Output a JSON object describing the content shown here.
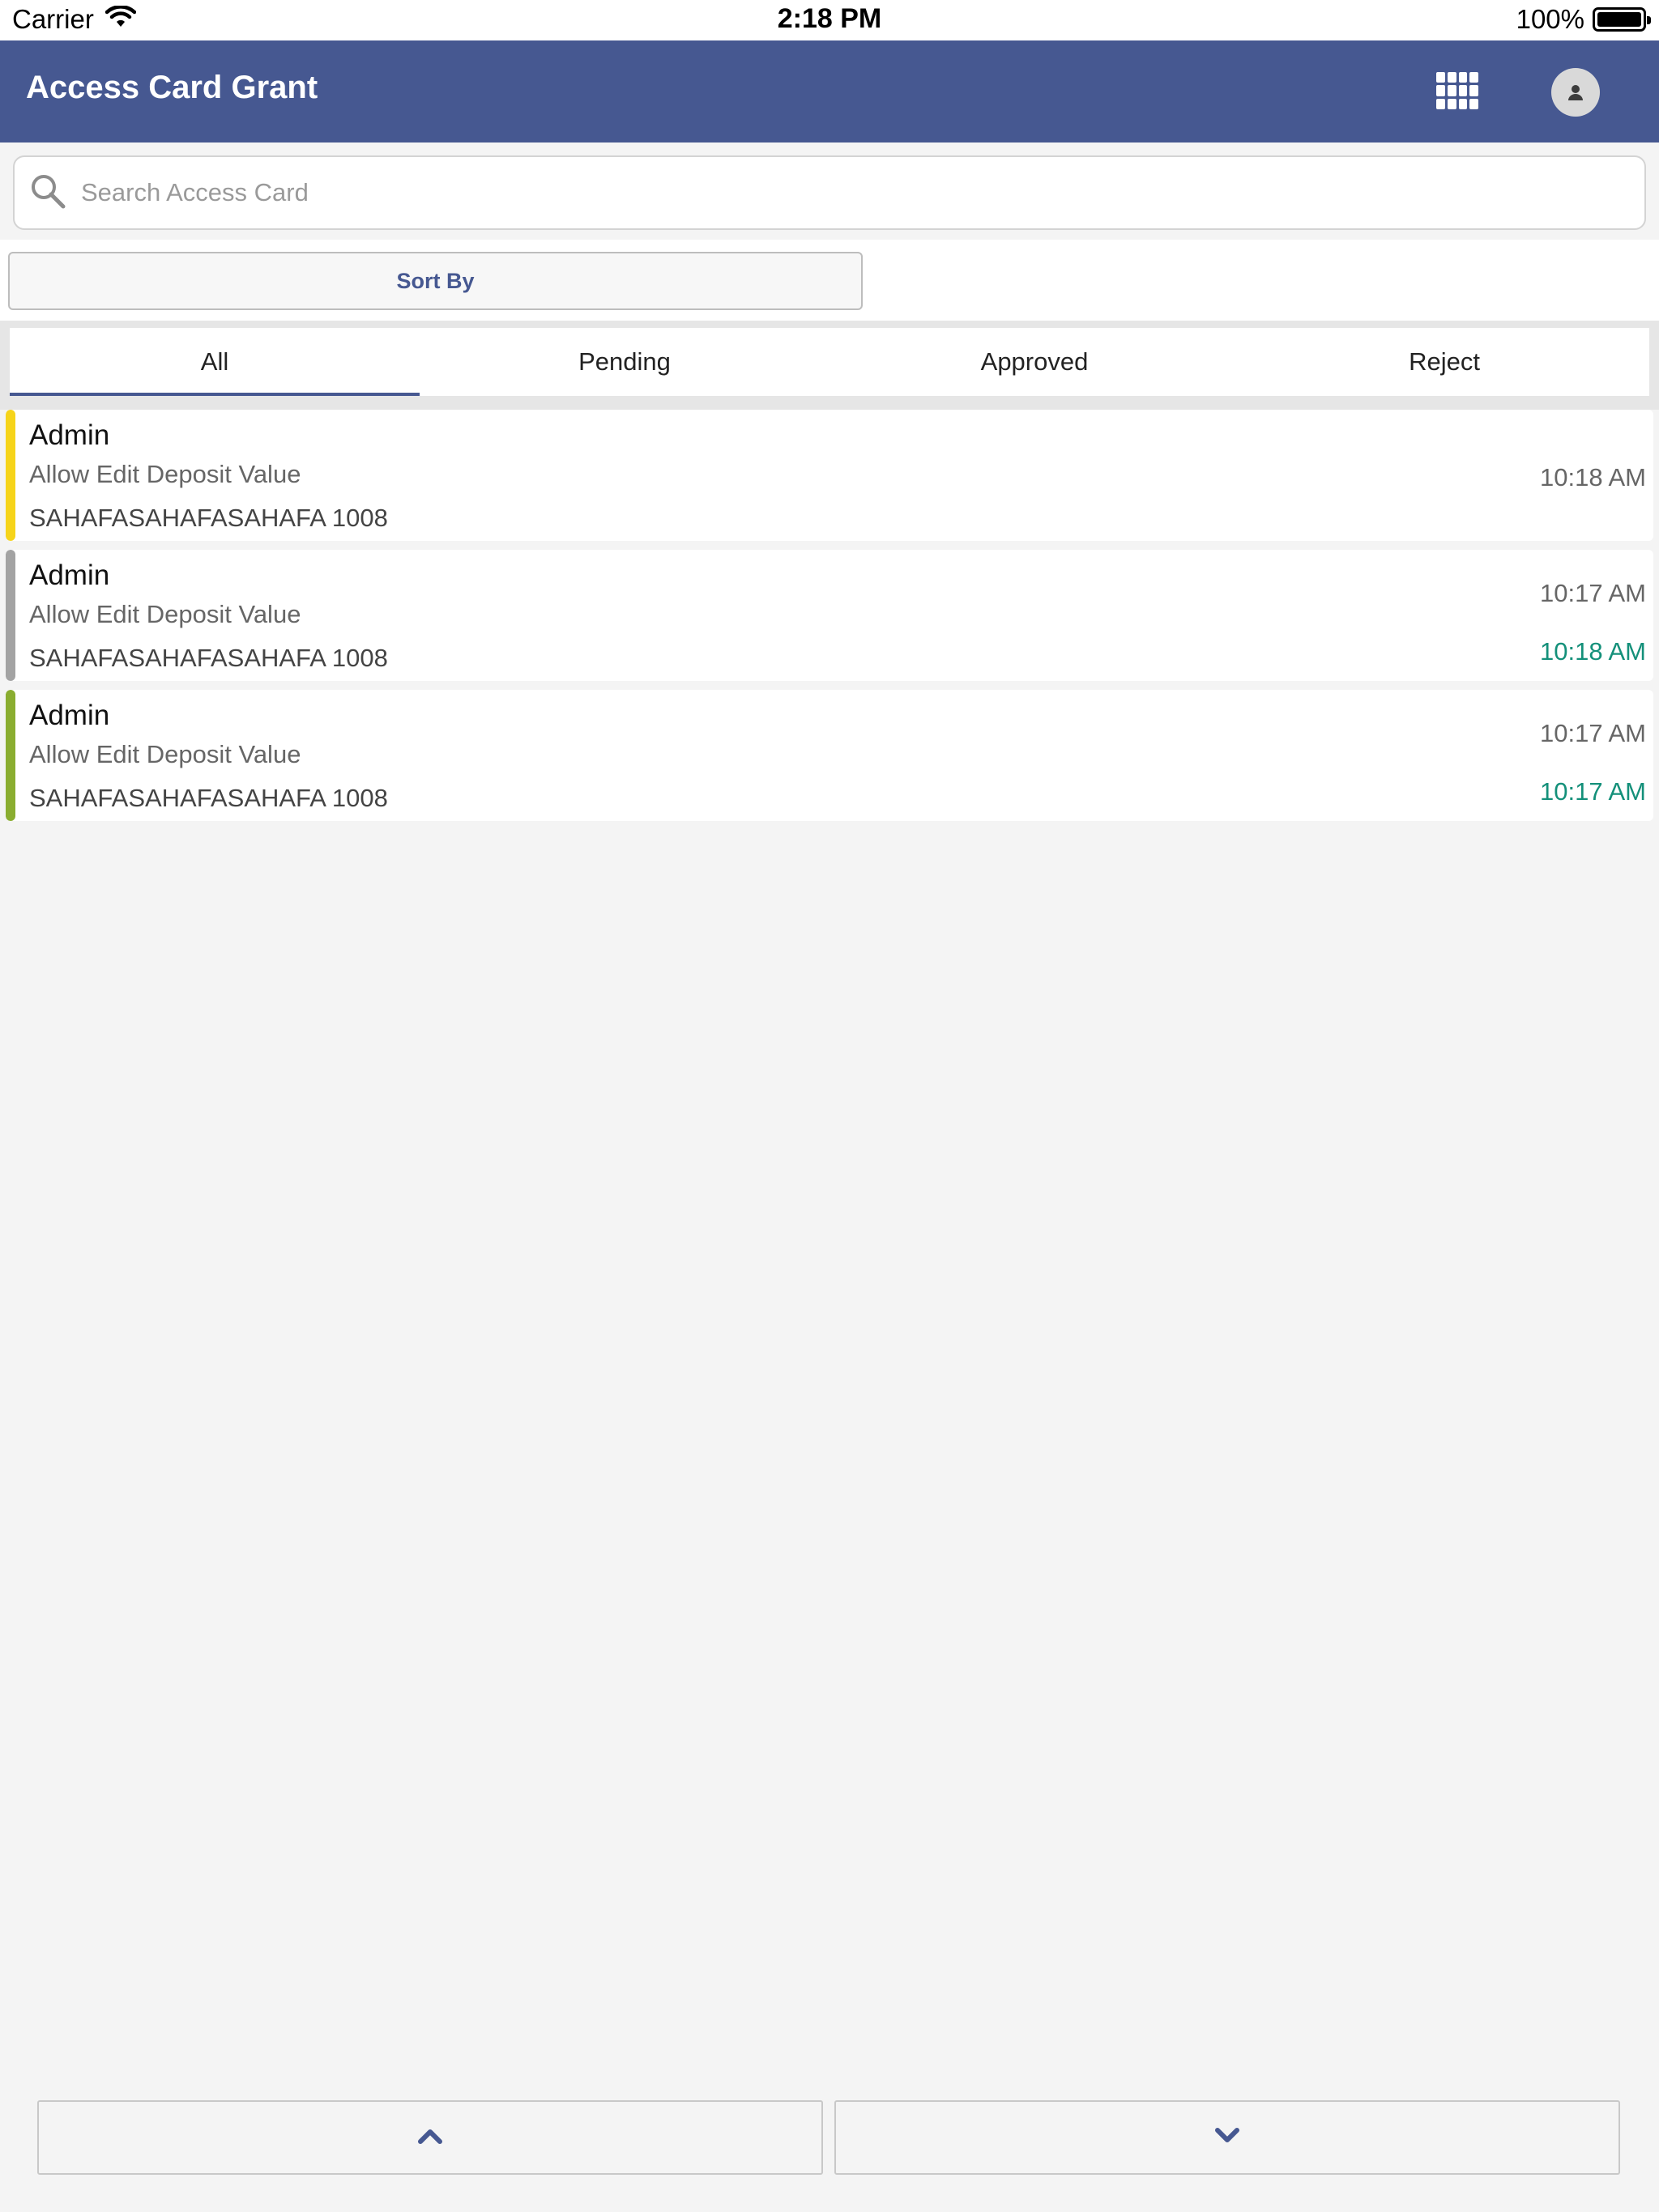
{
  "status_bar": {
    "carrier": "Carrier",
    "time": "2:18 PM",
    "battery": "100%"
  },
  "header": {
    "title": "Access Card Grant",
    "apps_icon": "grid-icon",
    "profile_icon": "user-avatar-icon"
  },
  "search": {
    "placeholder": "Search Access Card",
    "value": ""
  },
  "sort": {
    "label": "Sort By"
  },
  "tabs": [
    {
      "label": "All",
      "active": true
    },
    {
      "label": "Pending",
      "active": false
    },
    {
      "label": "Approved",
      "active": false
    },
    {
      "label": "Reject",
      "active": false
    }
  ],
  "items": [
    {
      "name": "Admin",
      "description": "Allow Edit Deposit Value",
      "code": "SAHAFASAHAFASAHAFA 1008",
      "time": "10:18 AM",
      "status_color": "#f6d41a"
    },
    {
      "name": "Admin",
      "description": "Allow Edit Deposit Value",
      "code": "SAHAFASAHAFASAHAFA 1008",
      "time": "10:17 AM",
      "secondary_time": "10:18 AM",
      "status_color": "#a3a3a3"
    },
    {
      "name": "Admin",
      "description": "Allow Edit Deposit Value",
      "code": "SAHAFASAHAFASAHAFA 1008",
      "time": "10:17 AM",
      "secondary_time": "10:17 AM",
      "status_color": "#8aad30"
    }
  ],
  "pagination": {
    "up_icon": "chevron-up-icon",
    "down_icon": "chevron-down-icon"
  },
  "colors": {
    "primary": "#465891",
    "secondary_time": "#14907a",
    "background": "#f4f4f4"
  }
}
